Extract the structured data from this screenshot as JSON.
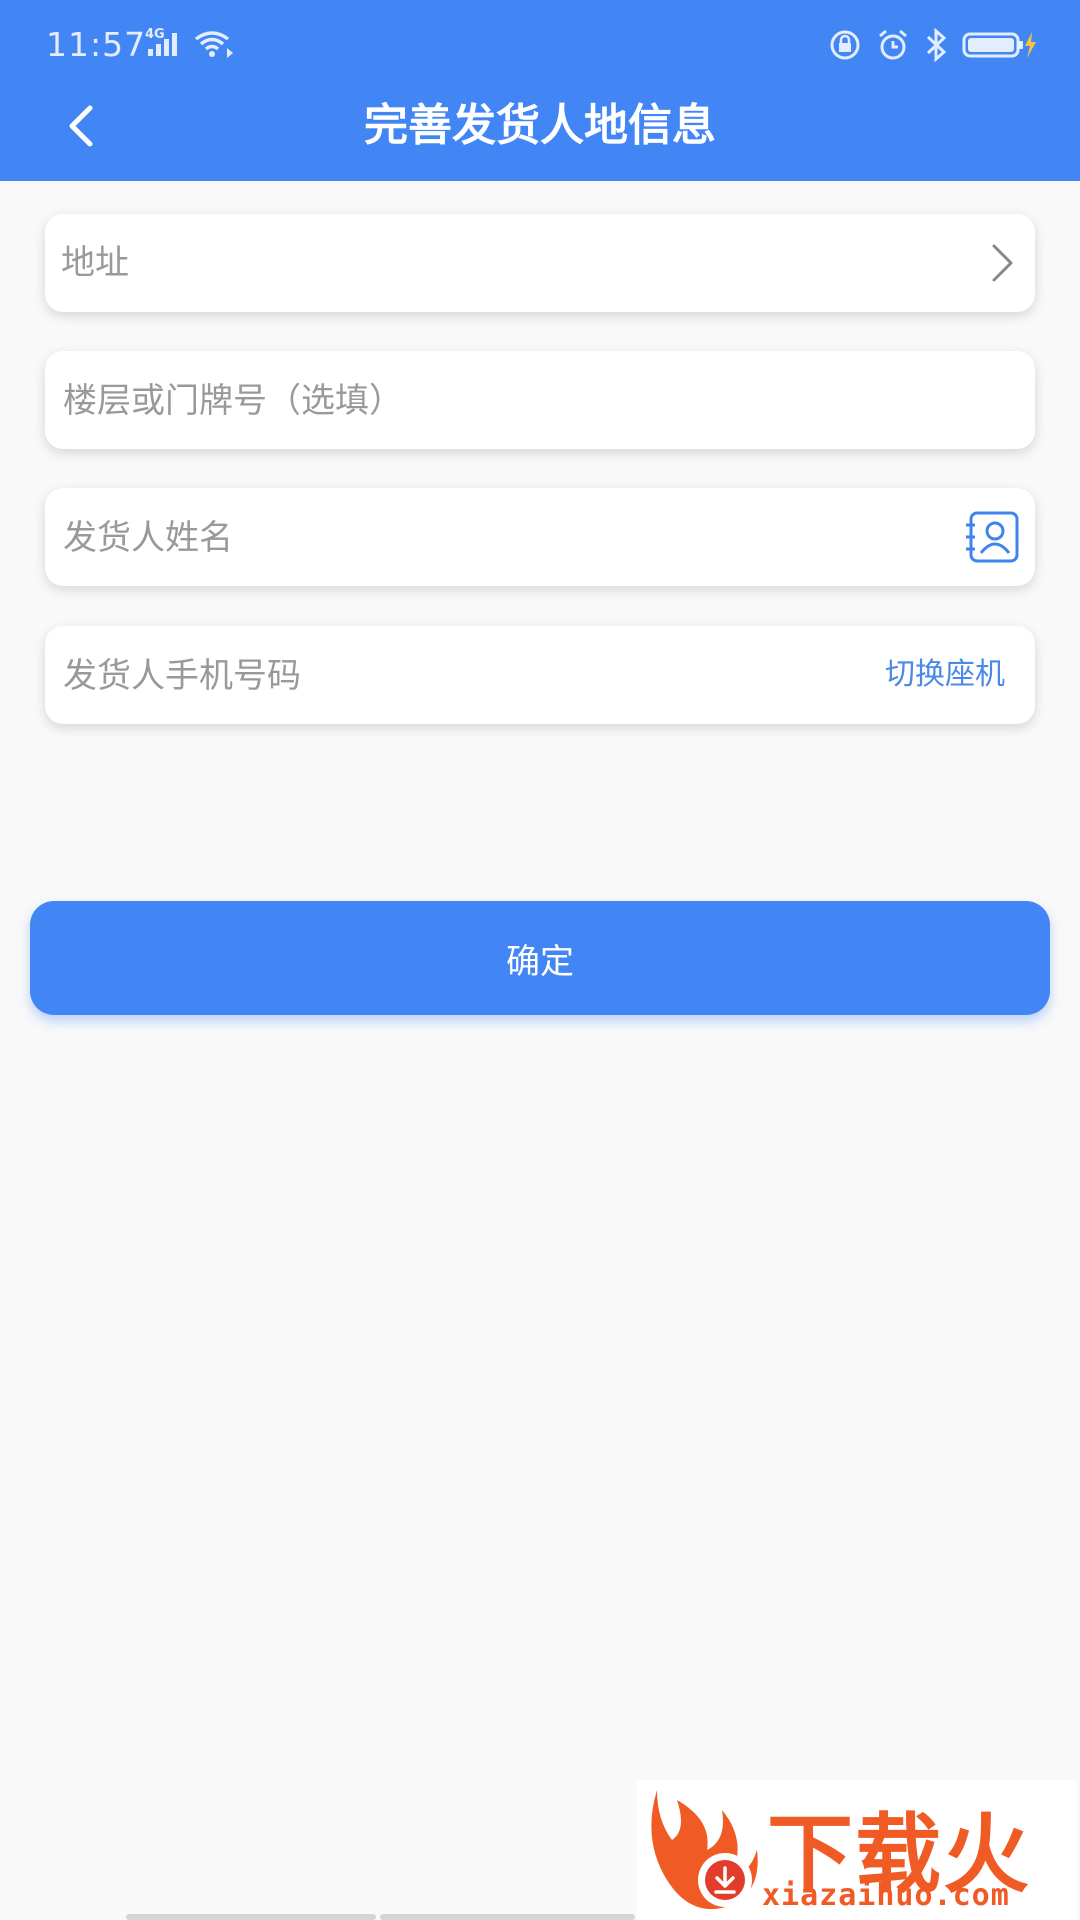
{
  "status_bar": {
    "time": "11:57",
    "network": "4G",
    "icons": [
      "signal-icon",
      "wifi-icon",
      "lock-rotation-icon",
      "alarm-icon",
      "bluetooth-icon",
      "battery-charging-icon"
    ]
  },
  "header": {
    "title": "完善发货人地信息",
    "back_icon": "chevron-left-icon",
    "background_color": "#4286f5"
  },
  "form": {
    "address": {
      "placeholder": "地址",
      "trailing_icon": "chevron-right-icon"
    },
    "floor": {
      "placeholder": "楼层或门牌号（选填）"
    },
    "name": {
      "placeholder": "发货人姓名",
      "trailing_icon": "contacts-icon"
    },
    "phone": {
      "placeholder": "发货人手机号码",
      "switch_label": "切换座机"
    }
  },
  "confirm_button": {
    "label": "确定",
    "color": "#4286f5"
  },
  "watermark": {
    "text": "下载火",
    "domain": "xiazaihuo.com",
    "color": "#f05a24"
  }
}
